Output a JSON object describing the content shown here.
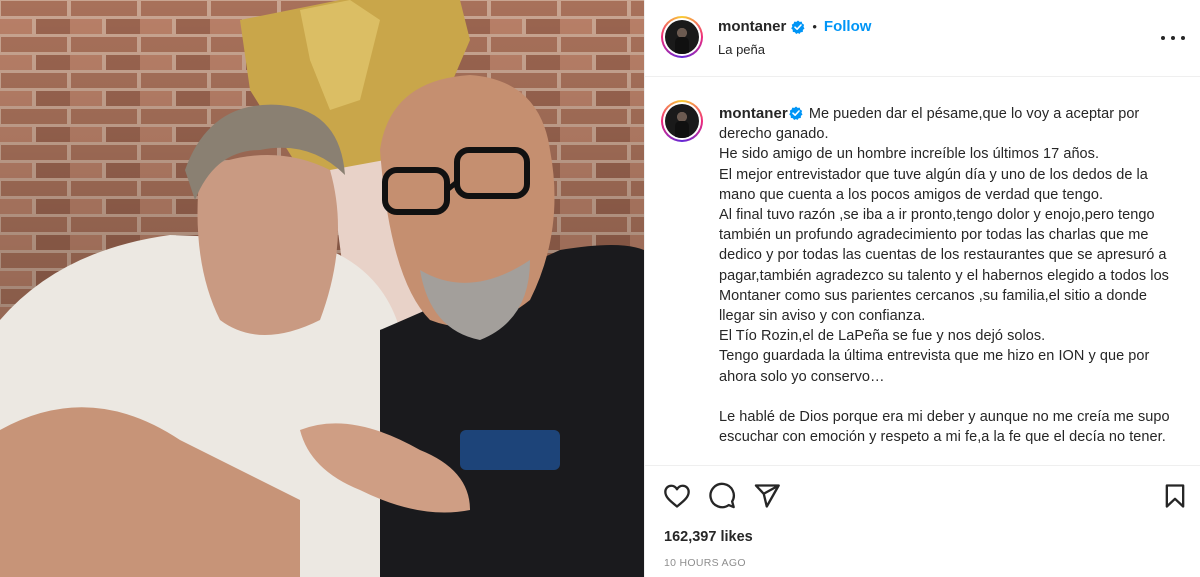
{
  "post": {
    "username": "montaner",
    "follow_label": "Follow",
    "location": "La peña",
    "separator": "•"
  },
  "caption": {
    "username": "montaner",
    "text": "Me pueden dar el pésame,que lo voy a aceptar por derecho ganado.\nHe sido amigo de un hombre increíble los últimos 17 años.\nEl mejor entrevistador que tuve algún día y uno de los dedos de la mano que cuenta a los pocos amigos de verdad que tengo.\nAl final tuvo razón ,se iba a ir pronto,tengo dolor y enojo,pero tengo también un profundo agradecimiento por todas las charlas que me dedico y por todas las cuentas de los restaurantes que se apresuró a pagar,también agradezco su talento y el habernos elegido a todos los Montaner como sus parientes cercanos ,su familia,el sitio a donde llegar sin aviso y con confianza.\nEl Tío Rozin,el de LaPeña se fue y nos dejó solos.\nTengo guardada la última entrevista que me hizo en ION y que por ahora solo yo conservo…\n\nLe hablé de Dios porque era mi deber y aunque no me creía me supo escuchar con emoción y respeto a mi fe,a la fe que el decía no tener."
  },
  "actions": {
    "likes_label": "162,397 likes",
    "timestamp": "10 HOURS AGO"
  },
  "icons": {
    "like": "heart-outline-icon",
    "comment": "comment-bubble-icon",
    "share": "paper-plane-icon",
    "save": "bookmark-icon",
    "more": "more-options-icon",
    "verified": "verified-badge-icon"
  },
  "colors": {
    "accent": "#0095f6",
    "text": "#262626",
    "muted": "#8e8e8e",
    "border": "#efefef"
  }
}
